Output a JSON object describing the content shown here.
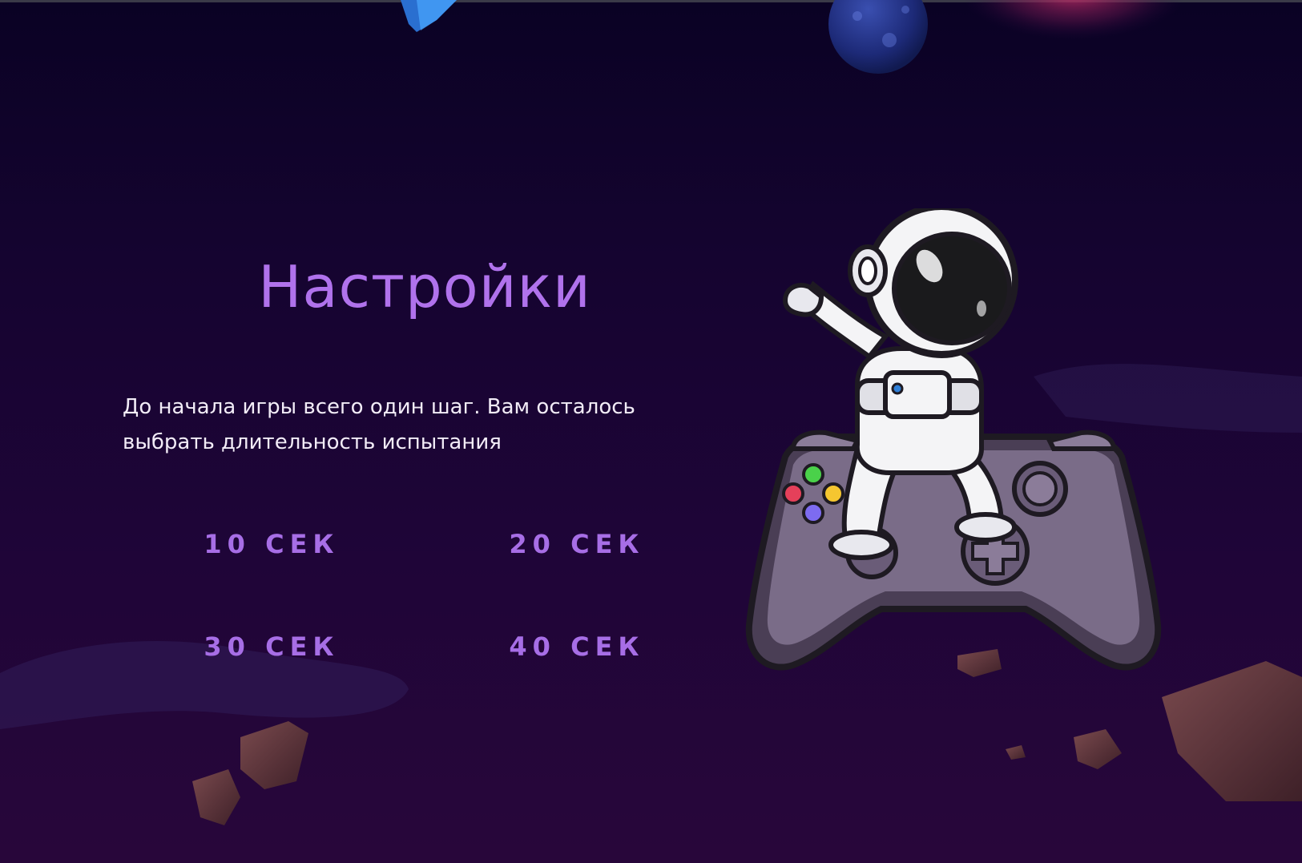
{
  "settings": {
    "title": "Настройки",
    "description": "До начала игры всего один шаг. Вам осталось выбрать длительность испытания",
    "options": [
      {
        "label": "10 СЕК"
      },
      {
        "label": "20 СЕК"
      },
      {
        "label": "30 СЕК"
      },
      {
        "label": "40 СЕК"
      }
    ]
  },
  "illustration": {
    "icon": "astronaut-on-gamepad-illustration"
  },
  "colors": {
    "accent": "#b072ec",
    "option_text": "#a76ee6",
    "text": "#f2ecf7",
    "background_top": "#0a0224",
    "background_bottom": "#28063a"
  }
}
